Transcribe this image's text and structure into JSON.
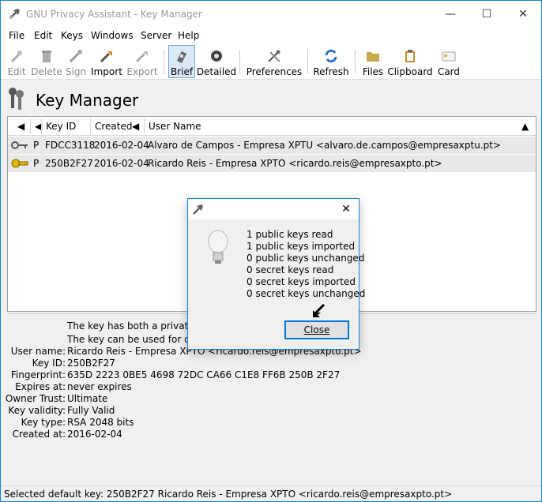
{
  "window": {
    "title": "GNU Privacy Assistant - Key Manager"
  },
  "menu": [
    "File",
    "Edit",
    "Keys",
    "Windows",
    "Server",
    "Help"
  ],
  "toolbar": {
    "edit": "Edit",
    "delete": "Delete",
    "sign": "Sign",
    "import": "Import",
    "export": "Export",
    "brief": "Brief",
    "detailed": "Detailed",
    "preferences": "Preferences",
    "refresh": "Refresh",
    "files": "Files",
    "clipboard": "Clipboard",
    "card": "Card"
  },
  "header": {
    "title": "Key Manager"
  },
  "columns": {
    "keyid": "Key ID",
    "created": "Created",
    "username": "User Name"
  },
  "keys": [
    {
      "type": "P",
      "keyid": "FDCC3118",
      "created": "2016-02-04",
      "user": "Alvaro de Campos - Empresa XPTU <alvaro.de.campos@empresaxptu.pt>"
    },
    {
      "type": "P",
      "keyid": "250B2F27",
      "created": "2016-02-04",
      "user": "Ricardo Reis - Empresa XPTO <ricardo.reis@empresaxpto.pt>"
    }
  ],
  "details": {
    "note1": "The key has both a private ar",
    "note2": "The key can be used for certi",
    "username_label": "User name:",
    "username": "Ricardo Reis - Empresa XPTO <ricardo.reis@empresaxpto.pt>",
    "keyid_label": "Key ID:",
    "keyid": "250B2F27",
    "fingerprint_label": "Fingerprint:",
    "fingerprint": "635D 2223 0BE5 4698 72DC  CA66 C1E8 FF6B 250B 2F27",
    "expires_label": "Expires at:",
    "expires": "never expires",
    "owner_label": "Owner Trust:",
    "owner": "Ultimate",
    "validity_label": "Key validity:",
    "validity": "Fully Valid",
    "type_label": "Key type:",
    "type": "RSA 2048 bits",
    "created_label": "Created at:",
    "created": "2016-02-04"
  },
  "status": {
    "text": "Selected default key:  250B2F27  Ricardo Reis - Empresa XPTO <ricardo.reis@empresaxpto.pt>"
  },
  "dialog": {
    "lines": [
      "1 public keys read",
      "1 public keys imported",
      "0 public keys unchanged",
      "0 secret keys read",
      "0 secret keys imported",
      "0 secret keys unchanged"
    ],
    "close": "Close"
  },
  "colors": {
    "accent": "#1883d7",
    "button_border": "#0078d7",
    "row_bg": "#e8e8e8"
  }
}
